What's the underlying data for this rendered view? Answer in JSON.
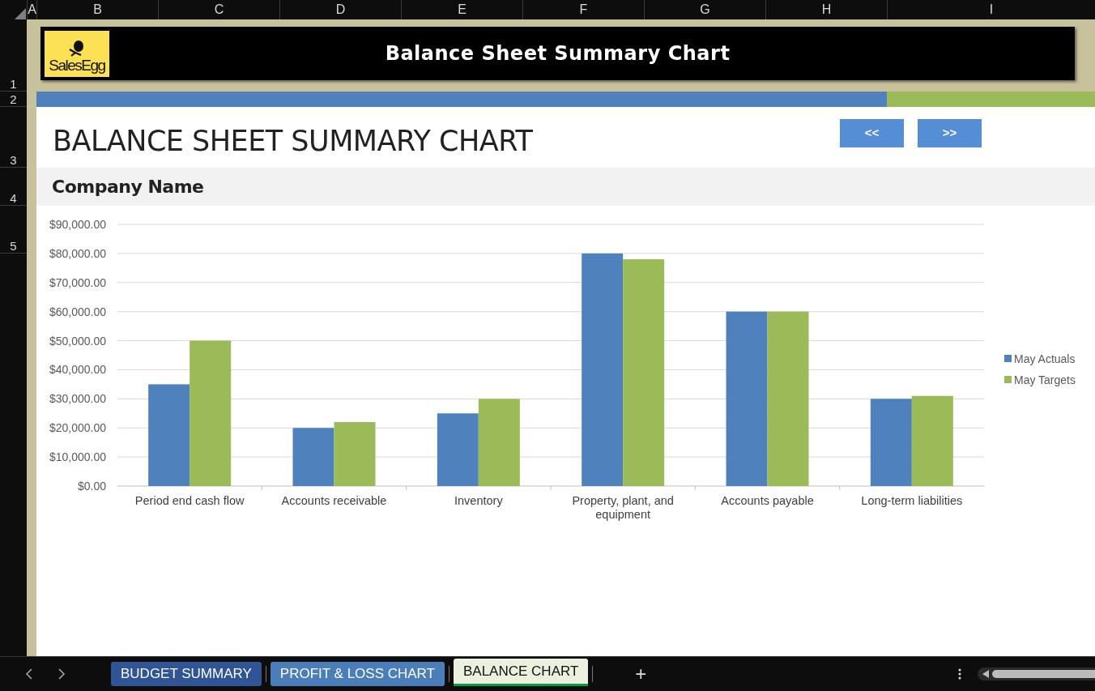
{
  "column_headers": [
    "A",
    "B",
    "C",
    "D",
    "E",
    "F",
    "G",
    "H",
    "I"
  ],
  "row_headers": [
    "1",
    "2",
    "3",
    "4",
    "5"
  ],
  "banner": {
    "logo_text": "SalesEgg",
    "title": "Balance Sheet Summary Chart"
  },
  "heading": "BALANCE SHEET SUMMARY CHART",
  "nav_buttons": [
    "<<",
    ">>"
  ],
  "company_name": "Company Name",
  "chart_data": {
    "type": "bar",
    "categories": [
      "Period end cash flow",
      "Accounts receivable",
      "Inventory",
      "Property, plant, and equipment",
      "Accounts payable",
      "Long-term liabilities"
    ],
    "series": [
      {
        "name": "May Actuals",
        "color": "#4f81bd",
        "values": [
          35000,
          20000,
          25000,
          80000,
          60000,
          30000
        ]
      },
      {
        "name": "May Targets",
        "color": "#9bbb59",
        "values": [
          50000,
          22000,
          30000,
          78000,
          60000,
          31000
        ]
      }
    ],
    "ylim": [
      0,
      90000
    ],
    "grid": true,
    "legend": true,
    "yticks": [
      {
        "value": 0,
        "label": "$0.00"
      },
      {
        "value": 10000,
        "label": "$10,000.00"
      },
      {
        "value": 20000,
        "label": "$20,000.00"
      },
      {
        "value": 30000,
        "label": "$30,000.00"
      },
      {
        "value": 40000,
        "label": "$40,000.00"
      },
      {
        "value": 50000,
        "label": "$50,000.00"
      },
      {
        "value": 60000,
        "label": "$60,000.00"
      },
      {
        "value": 70000,
        "label": "$70,000.00"
      },
      {
        "value": 80000,
        "label": "$80,000.00"
      },
      {
        "value": 90000,
        "label": "$90,000.00"
      }
    ]
  },
  "sheet_tabs": [
    {
      "label": "BUDGET SUMMARY",
      "selected": false,
      "color": "#2f5597"
    },
    {
      "label": "PROFIT & LOSS CHART",
      "selected": false,
      "color": "#4a7ebb"
    },
    {
      "label": "BALANCE CHART",
      "selected": true,
      "color": "#00a040"
    }
  ],
  "add_sheet_button": "+"
}
